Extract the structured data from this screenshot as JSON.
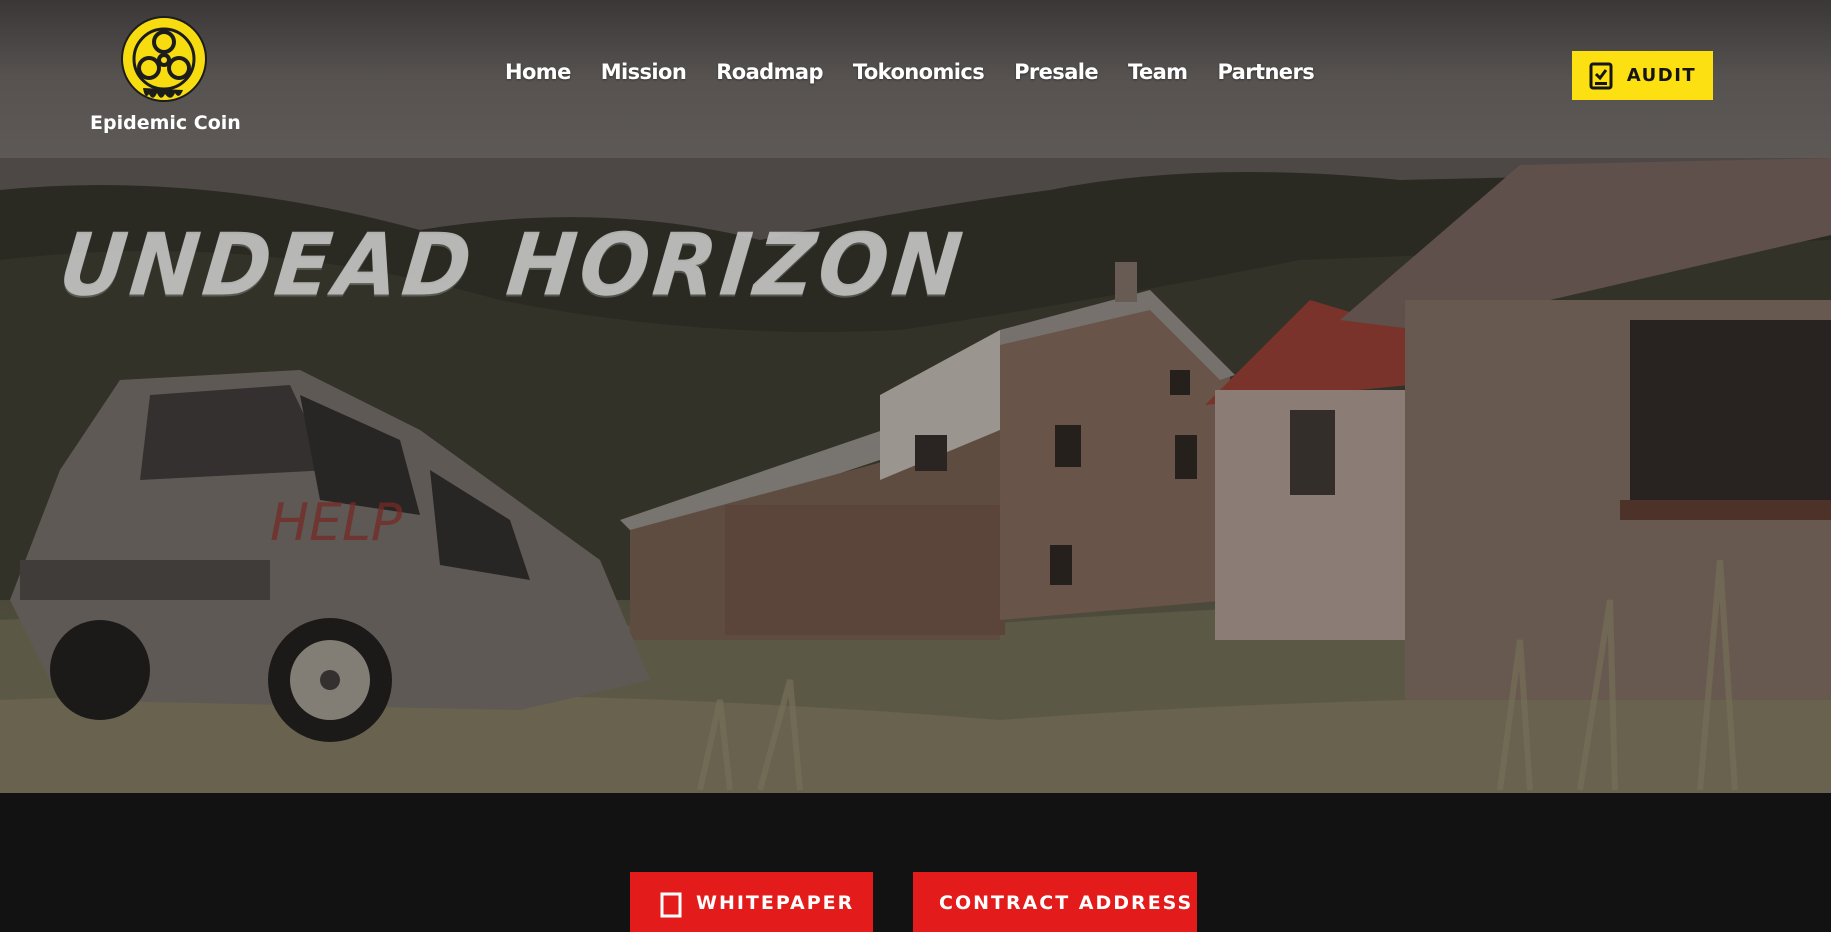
{
  "brand": {
    "name": "Epidemic Coin",
    "logo_icon": "biohazard-icon",
    "accent": "#fde012"
  },
  "nav": {
    "items": [
      {
        "label": "Home"
      },
      {
        "label": "Mission"
      },
      {
        "label": "Roadmap"
      },
      {
        "label": "Tokonomics"
      },
      {
        "label": "Presale"
      },
      {
        "label": "Team"
      },
      {
        "label": "Partners"
      }
    ]
  },
  "audit": {
    "label": "AUDIT",
    "icon": "checklist-icon"
  },
  "hero": {
    "title": "UNDEAD  HORIZON",
    "graffiti": "HELP"
  },
  "cta": {
    "whitepaper_label": "WHITEPAPER",
    "contract_label": "CONTRACT ADDRESS",
    "color": "#e31b1b"
  }
}
